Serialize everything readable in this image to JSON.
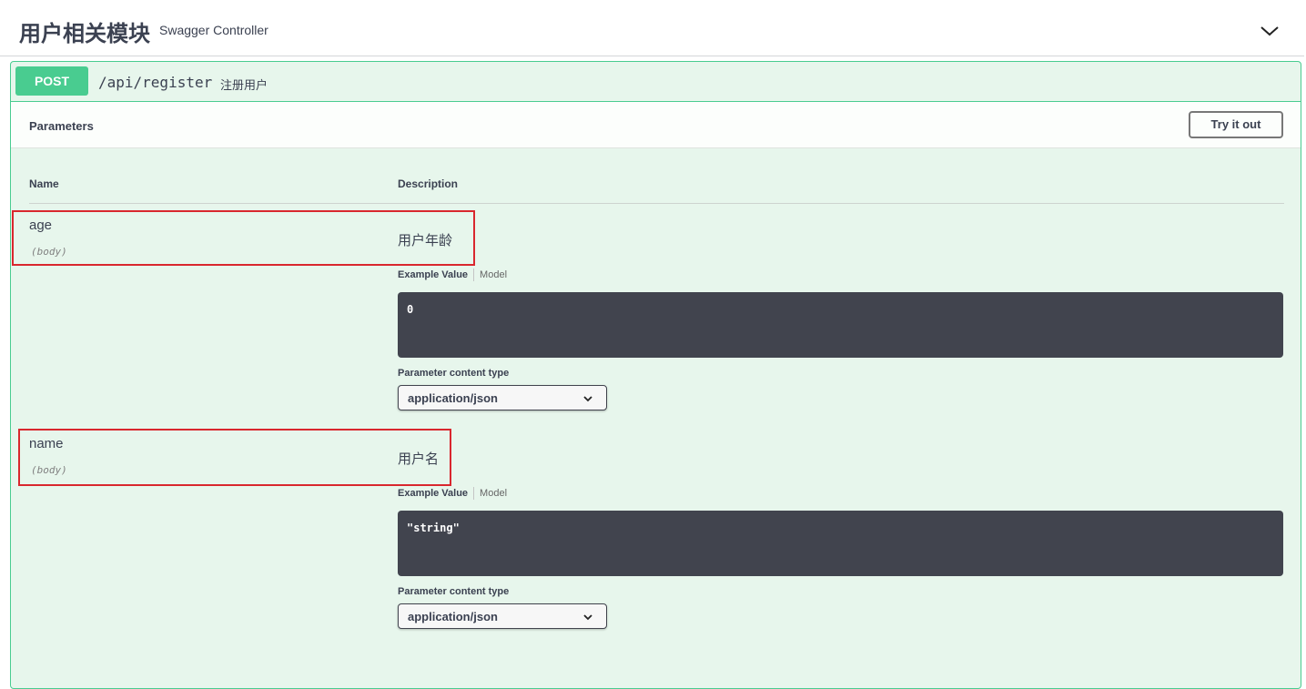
{
  "tag": {
    "title": "用户相关模块",
    "description": "Swagger Controller"
  },
  "operation": {
    "method": "POST",
    "path": "/api/register",
    "summary": "注册用户",
    "method_color": "#49cc90"
  },
  "parameters_section": {
    "title": "Parameters",
    "try_button": "Try it out",
    "columns": {
      "name": "Name",
      "description": "Description"
    }
  },
  "params": [
    {
      "name": "age",
      "in": "(body)",
      "description": "用户年龄",
      "example_tab": "Example Value",
      "model_tab": "Model",
      "example": "0",
      "content_type_label": "Parameter content type",
      "content_type": "application/json"
    },
    {
      "name": "name",
      "in": "(body)",
      "description": "用户名",
      "example_tab": "Example Value",
      "model_tab": "Model",
      "example": "\"string\"",
      "content_type_label": "Parameter content type",
      "content_type": "application/json"
    }
  ]
}
